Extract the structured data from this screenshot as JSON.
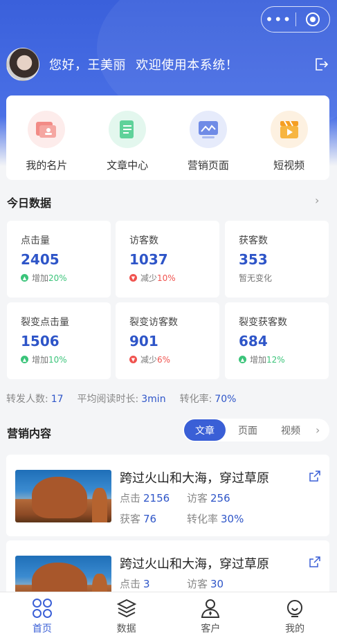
{
  "header": {
    "greeting": "您好，王美丽",
    "welcome": "欢迎使用本系统！",
    "menu_icon": "more-dots-icon",
    "capsule_icon": "target-circle-icon",
    "logout_icon": "logout-icon"
  },
  "shortcuts": [
    {
      "label": "我的名片",
      "icon": "business-card-icon"
    },
    {
      "label": "文章中心",
      "icon": "article-scroll-icon"
    },
    {
      "label": "营销页面",
      "icon": "marketing-chart-icon"
    },
    {
      "label": "短视频",
      "icon": "clapperboard-icon"
    }
  ],
  "today": {
    "title": "今日数据",
    "cards": [
      {
        "title": "点击量",
        "value": "2405",
        "trend_text": "增加",
        "pct": "20%",
        "trend": "up"
      },
      {
        "title": "访客数",
        "value": "1037",
        "trend_text": "减少",
        "pct": "10%",
        "trend": "down"
      },
      {
        "title": "获客数",
        "value": "353",
        "trend_text": "暂无变化",
        "pct": "",
        "trend": "none"
      },
      {
        "title": "裂变点击量",
        "value": "1506",
        "trend_text": "增加",
        "pct": "10%",
        "trend": "up"
      },
      {
        "title": "裂变访客数",
        "value": "901",
        "trend_text": "减少",
        "pct": "6%",
        "trend": "down"
      },
      {
        "title": "裂变获客数",
        "value": "684",
        "trend_text": "增加",
        "pct": "12%",
        "trend": "up"
      }
    ]
  },
  "summary": {
    "forward_label": "转发人数:",
    "forward_value": "17",
    "read_label": "平均阅读时长:",
    "read_value": "3min",
    "conv_label": "转化率:",
    "conv_value": "70%"
  },
  "marketing": {
    "title": "营销内容",
    "tabs": [
      "文章",
      "页面",
      "视频"
    ],
    "active_tab": "文章",
    "articles": [
      {
        "title": "跨过火山和大海，穿过草原",
        "click_label": "点击",
        "click": "2156",
        "visitor_label": "访客",
        "visitor": "256",
        "gain_label": "获客",
        "gain": "76",
        "conv_label": "转化率",
        "conv": "30%"
      },
      {
        "title": "跨过火山和大海，穿过草原",
        "click_label": "点击",
        "click": "3",
        "visitor_label": "访客",
        "visitor": "30"
      }
    ]
  },
  "tabbar": [
    {
      "label": "首页",
      "icon": "home-grid-icon",
      "active": true
    },
    {
      "label": "数据",
      "icon": "layers-icon",
      "active": false
    },
    {
      "label": "客户",
      "icon": "customer-icon",
      "active": false
    },
    {
      "label": "我的",
      "icon": "profile-icon",
      "active": false
    }
  ],
  "colors": {
    "primary": "#3a5fd6",
    "up": "#3bc47a",
    "down": "#f0534f"
  }
}
